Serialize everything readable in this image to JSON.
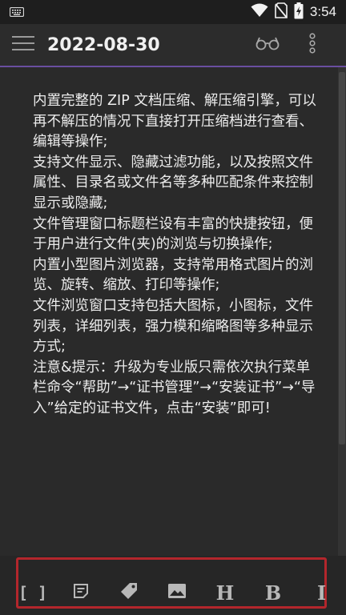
{
  "status_bar": {
    "time": "3:54",
    "icons": [
      "keyboard-icon",
      "wifi-icon",
      "no-sim-icon",
      "battery-charging-icon"
    ]
  },
  "header": {
    "title": "2022-08-30",
    "icons": [
      "menu-icon",
      "reading-glasses-icon",
      "more-vert-icon"
    ]
  },
  "document": {
    "paragraphs": [
      "内置完整的 ZIP 文档压缩、解压缩引擎，可以再不解压的情况下直接打开压缩档进行查看、编辑等操作;",
      "支持文件显示、隐藏过滤功能，以及按照文件属性、目录名或文件名等多种匹配条件来控制显示或隐藏;",
      "文件管理窗口标题栏设有丰富的快捷按钮，便于用户进行文件(夹)的浏览与切换操作;",
      "内置小型图片浏览器，支持常用格式图片的浏览、旋转、缩放、打印等操作;",
      "文件浏览窗口支持包括大图标，小图标，文件列表，详细列表，强力模和缩略图等多种显示方式;",
      "注意&提示：升级为专业版只需依次执行菜单栏命令“帮助”→“证书管理”→“安装证书”→“导入”给定的证书文件，点击“安装”即可!"
    ]
  },
  "toolbar": {
    "tools": [
      {
        "icon": "brackets-icon",
        "label": "[ ]"
      },
      {
        "icon": "note-icon",
        "label": ""
      },
      {
        "icon": "tag-icon",
        "label": ""
      },
      {
        "icon": "image-icon",
        "label": ""
      },
      {
        "icon": "heading-icon",
        "label": "H"
      },
      {
        "icon": "bold-icon",
        "label": "B"
      },
      {
        "icon": "italic-icon",
        "label": "I"
      }
    ]
  },
  "colors": {
    "accent_line": "#6a4ea0",
    "highlight_border": "#b3262c",
    "background": "#2a2a2a"
  }
}
